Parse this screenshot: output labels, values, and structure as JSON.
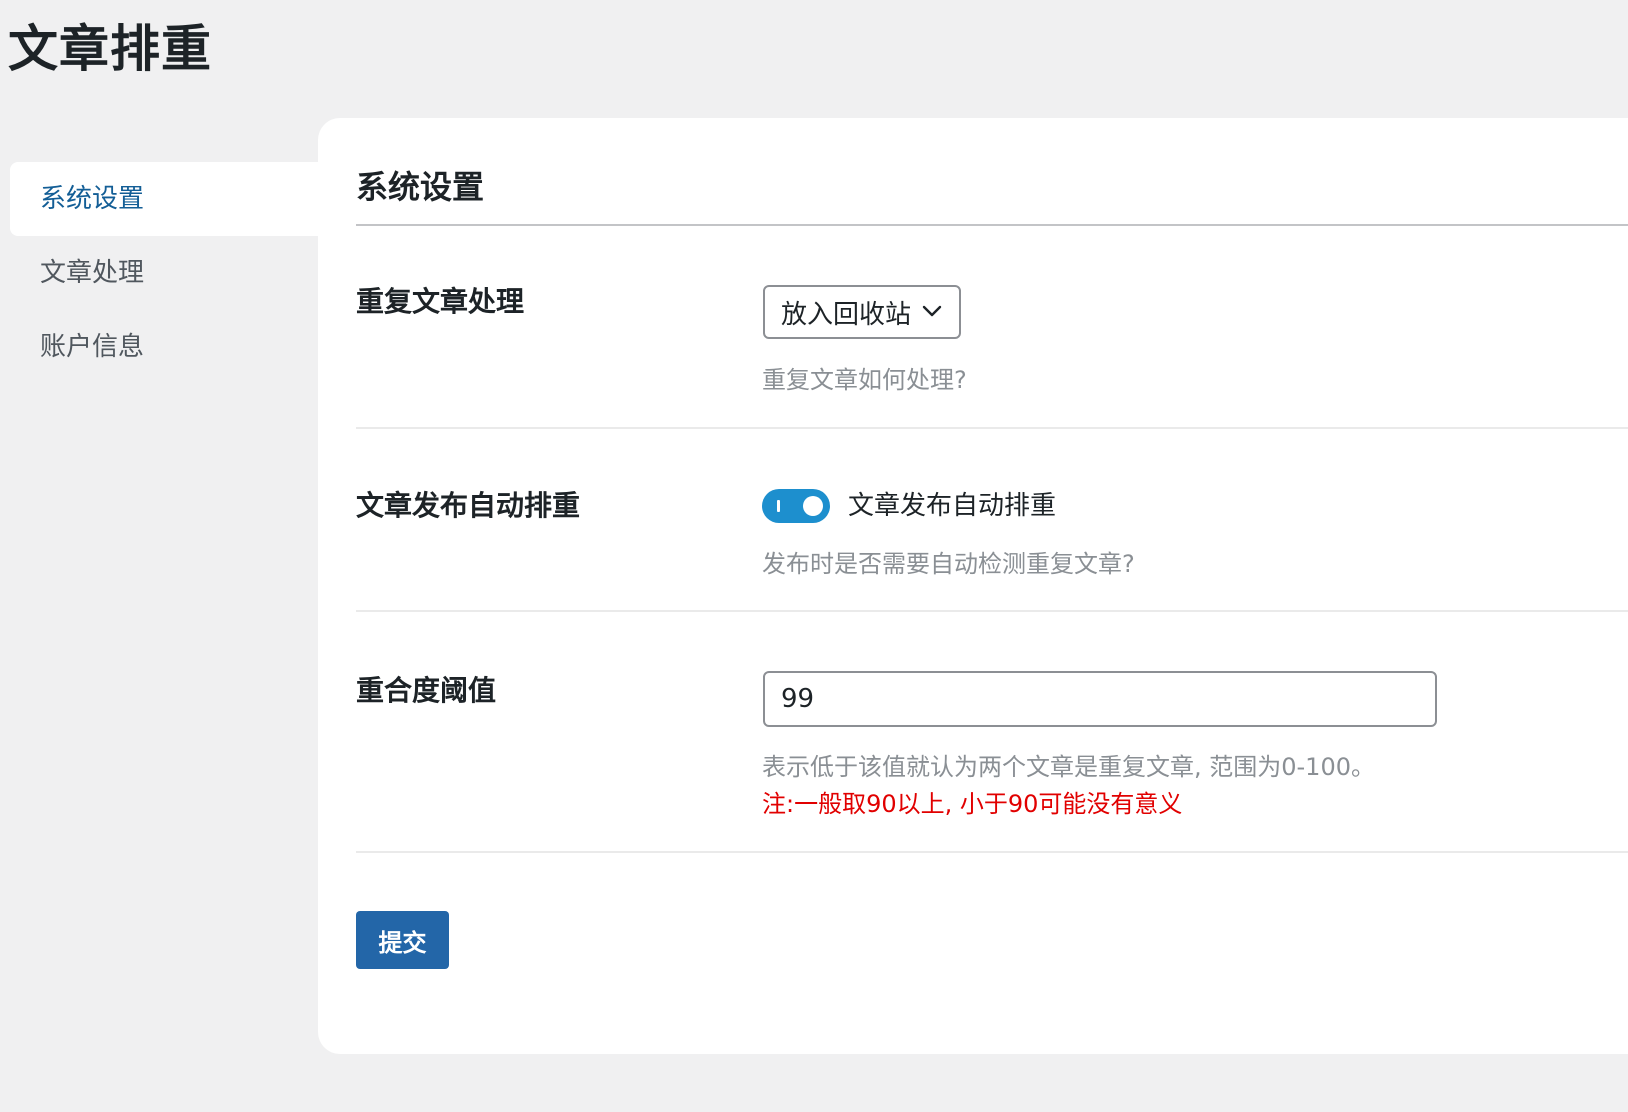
{
  "page": {
    "title": "文章排重"
  },
  "sidebar": {
    "items": [
      {
        "label": "系统设置",
        "active": true
      },
      {
        "label": "文章处理",
        "active": false
      },
      {
        "label": "账户信息",
        "active": false
      }
    ]
  },
  "panel": {
    "title": "系统设置"
  },
  "fields": {
    "duplicate_handling": {
      "label": "重复文章处理",
      "selected": "放入回收站",
      "help": "重复文章如何处理?"
    },
    "auto_dedup": {
      "label": "文章发布自动排重",
      "toggle_label": "文章发布自动排重",
      "enabled": true,
      "help": "发布时是否需要自动检测重复文章?"
    },
    "threshold": {
      "label": "重合度阈值",
      "value": "99",
      "help": "表示低于该值就认为两个文章是重复文章, 范围为0-100。",
      "note": "注:一般取90以上, 小于90可能没有意义"
    }
  },
  "actions": {
    "submit_label": "提交"
  },
  "colors": {
    "accent": "#135e96",
    "toggle_on": "#1d8fce",
    "submit": "#2366a8",
    "note": "#e10000"
  }
}
